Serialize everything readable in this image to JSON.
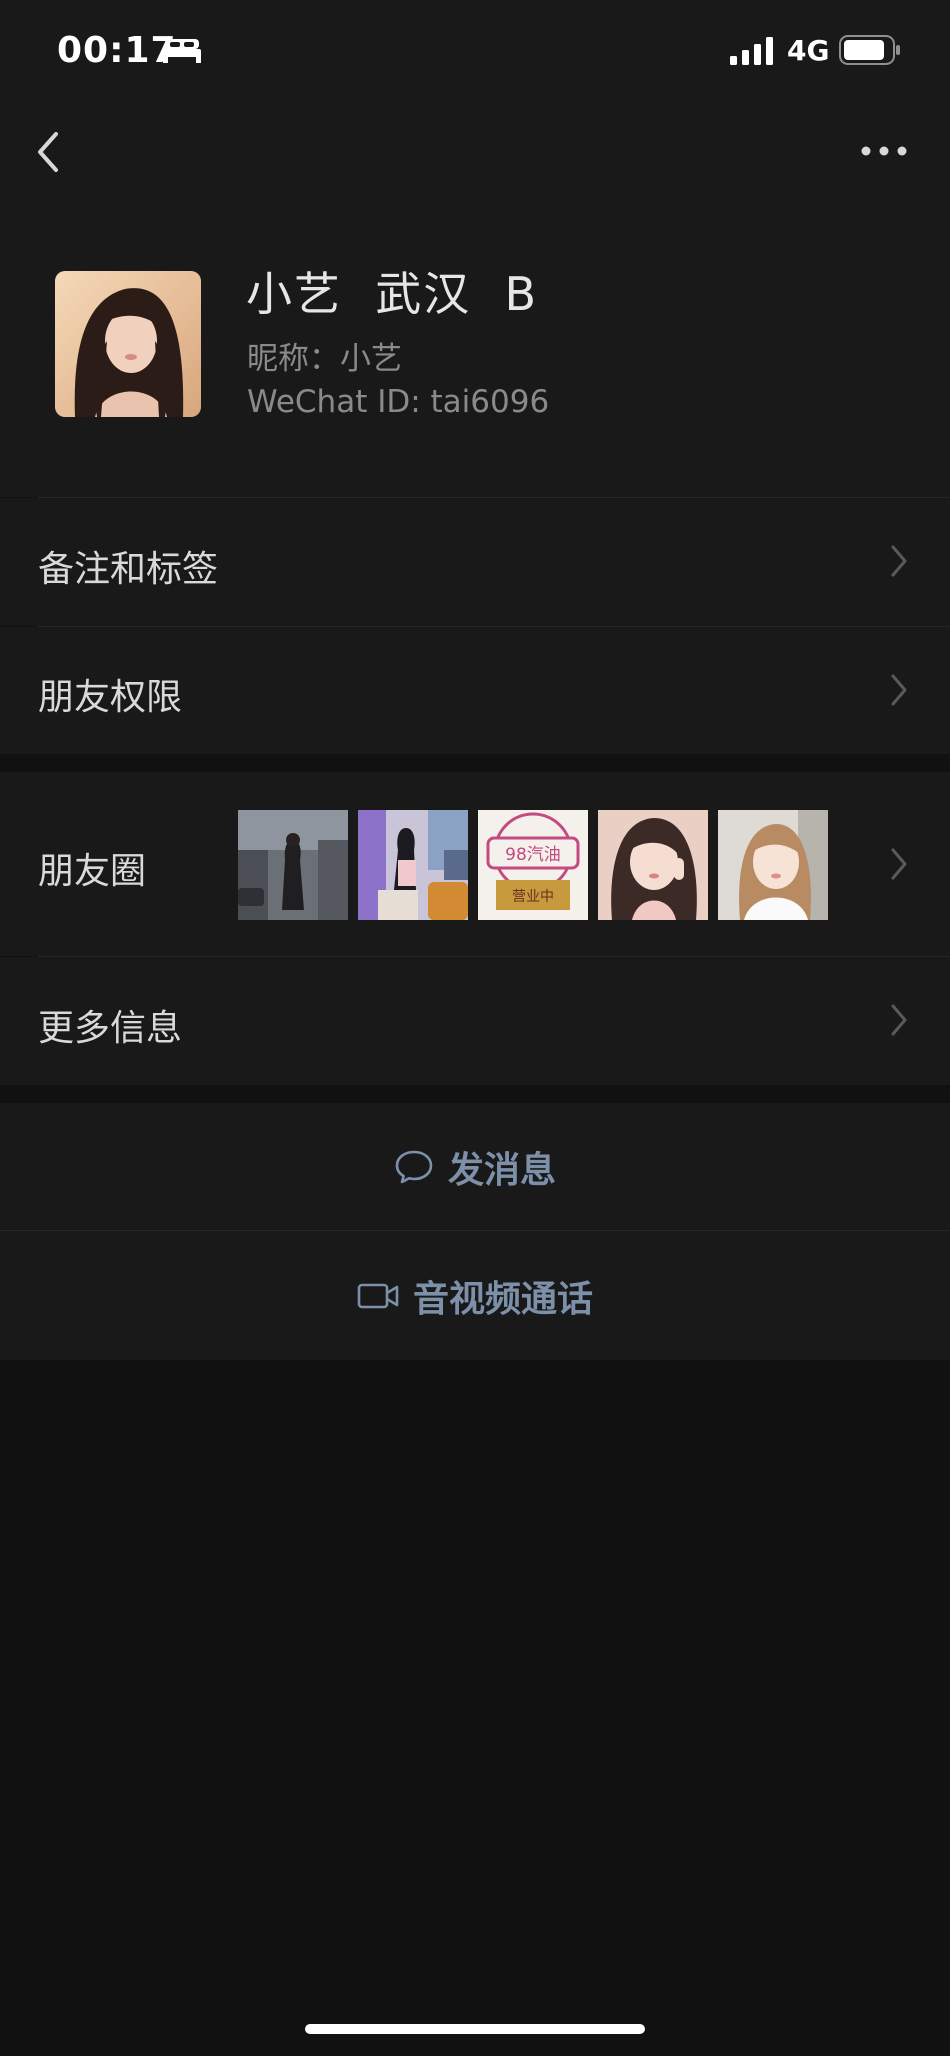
{
  "status_bar": {
    "time": "00:17",
    "network": "4G",
    "sleep_icon": "bed-icon",
    "signal_icon": "signal-bars-icon",
    "battery_icon": "battery-icon"
  },
  "nav": {
    "back_icon": "chevron-left-icon",
    "more_icon": "more-dots-icon"
  },
  "profile": {
    "name": "小艺  武汉  B",
    "nickname": "昵称：小艺",
    "wechat_id": "WeChat ID: tai6096"
  },
  "rows": {
    "remarks_tags": "备注和标签",
    "friend_permissions": "朋友权限",
    "moments": "朋友圈",
    "more_info": "更多信息"
  },
  "moments_thumbnails": [
    {
      "name": "moment-photo-street"
    },
    {
      "name": "moment-photo-room"
    },
    {
      "name": "moment-photo-fuel-stamp",
      "stamp_text": "98汽油",
      "stamp_subtext": "营业中"
    },
    {
      "name": "moment-photo-selfie"
    },
    {
      "name": "moment-photo-portrait"
    }
  ],
  "actions": {
    "send_message": "发消息",
    "video_call": "音视频通话"
  },
  "colors": {
    "background": "#111111",
    "cell": "#191919",
    "action_text": "#7d90a9",
    "secondary_text": "#8a8a8a"
  }
}
